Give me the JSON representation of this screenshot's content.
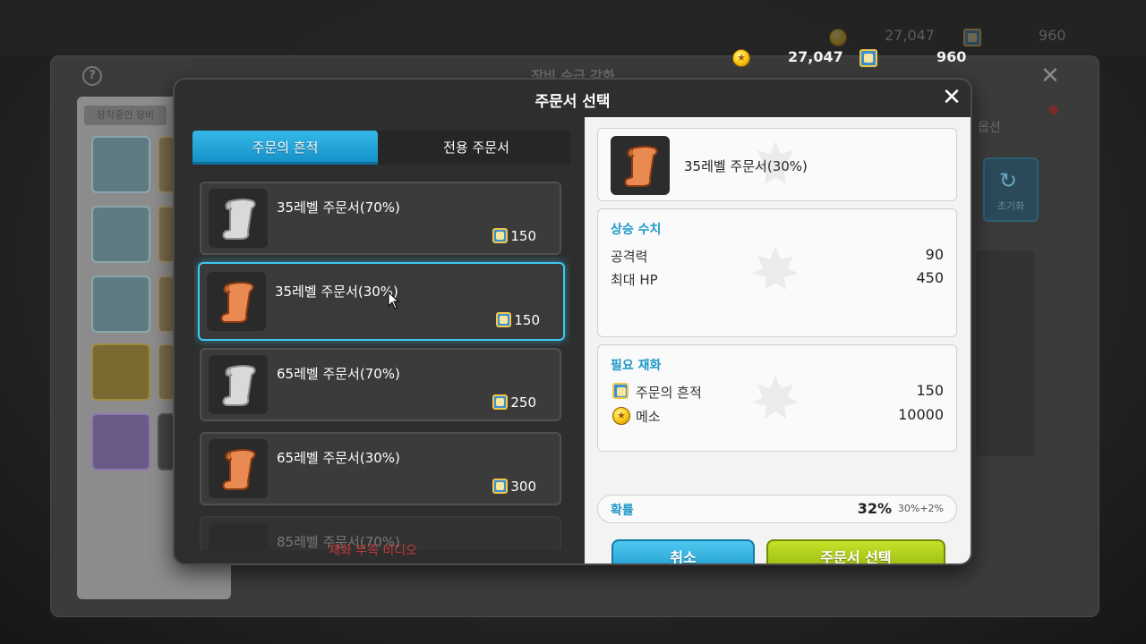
{
  "background": {
    "panel_title": "장비 승급 강화",
    "left_tab": "장착중인 장비",
    "right_label": "옵션",
    "reset_label": "초기화",
    "currency": {
      "meso": "27,047",
      "tickets": "960"
    }
  },
  "currency": {
    "meso": "27,047",
    "tickets": "960"
  },
  "modal": {
    "title": "주문서 선택",
    "tabs": [
      {
        "label": "주문의 흔적",
        "active": true
      },
      {
        "label": "전용 주문서",
        "active": false
      }
    ],
    "items": [
      {
        "label": "35레벨 주문서(70%)",
        "price": "150",
        "color": "gray"
      },
      {
        "label": "35레벨 주문서(30%)",
        "price": "150",
        "color": "orange",
        "selected": true
      },
      {
        "label": "65레벨 주문서(70%)",
        "price": "250",
        "color": "gray"
      },
      {
        "label": "65레벨 주문서(30%)",
        "price": "300",
        "color": "orange"
      },
      {
        "label": "85레벨 주문서(70%)",
        "price": "",
        "color": "gray"
      }
    ],
    "warning_text": "재화 부족 비디오",
    "detail": {
      "name": "35레벨 주문서(30%)",
      "increase_title": "상승 수치",
      "stats": [
        {
          "label": "공격력",
          "value": "90"
        },
        {
          "label": "최대 HP",
          "value": "450"
        }
      ],
      "required_title": "필요 재화",
      "costs": [
        {
          "label": "주문의 흔적",
          "value": "150",
          "icon": "ticket-icon"
        },
        {
          "label": "메소",
          "value": "10000",
          "icon": "coin-icon"
        }
      ],
      "probability_label": "확률",
      "probability_value": "32%",
      "probability_breakdown": "30%+2%",
      "cancel_label": "취소",
      "select_label": "주문서 선택"
    }
  },
  "colors": {
    "accent_blue": "#1d98c8",
    "select_green": "#9cc21a",
    "selection_glow": "#3fc9ef"
  }
}
